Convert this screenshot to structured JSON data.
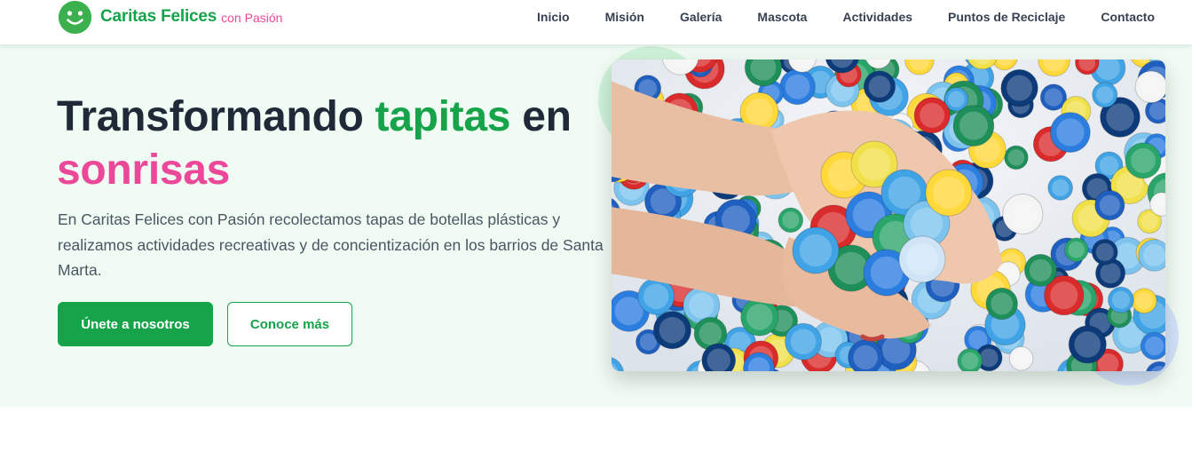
{
  "brand": {
    "name": "Caritas Felices",
    "tagline": "con Pasión",
    "logo_icon": "smiley-face-icon"
  },
  "nav": {
    "items": [
      {
        "label": "Inicio"
      },
      {
        "label": "Misión"
      },
      {
        "label": "Galería"
      },
      {
        "label": "Mascota"
      },
      {
        "label": "Actividades"
      },
      {
        "label": "Puntos de Reciclaje"
      },
      {
        "label": "Contacto"
      }
    ]
  },
  "hero": {
    "headline": {
      "part1": "Transformando ",
      "part2": "tapitas",
      "part3": " en",
      "part4": "sonrisas"
    },
    "description": "En Caritas Felices con Pasión recolectamos tapas de botellas plásticas y realizamos actividades recreativas y de concientización en los barrios de Santa Marta.",
    "primary_button": "Únete a nosotros",
    "secondary_button": "Conoce más",
    "image_subject": "hands-holding-plastic-bottle-caps"
  },
  "colors": {
    "brand_green": "#16a34a",
    "accent_pink": "#ec4899",
    "hero_bg": "#effbf3",
    "text_dark": "#1f2937",
    "text_body": "#4b5563"
  }
}
